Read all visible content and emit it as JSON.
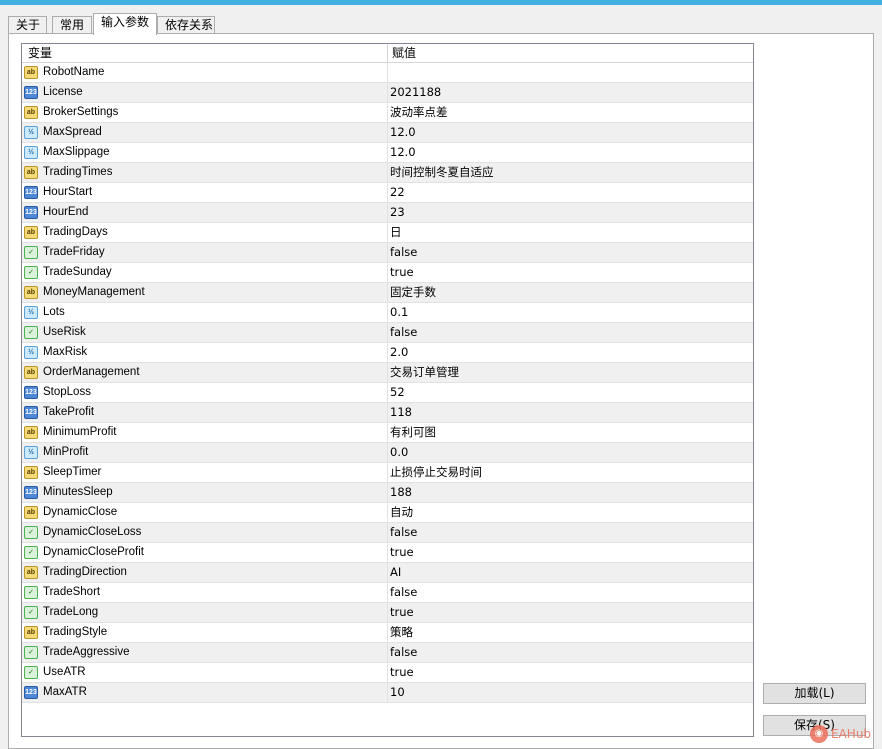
{
  "tabs": [
    {
      "label": "关于",
      "active": false
    },
    {
      "label": "常用",
      "active": false
    },
    {
      "label": "输入参数",
      "active": true
    },
    {
      "label": "依存关系",
      "active": false
    }
  ],
  "grid": {
    "columns": {
      "variable": "变量",
      "value": "赋值"
    },
    "rows": [
      {
        "type": "ab",
        "name": "RobotName",
        "value": ""
      },
      {
        "type": "123",
        "name": "License",
        "value": "2021188"
      },
      {
        "type": "ab",
        "name": "BrokerSettings",
        "value": "波动率点差"
      },
      {
        "type": "½",
        "name": "MaxSpread",
        "value": "12.0"
      },
      {
        "type": "½",
        "name": "MaxSlippage",
        "value": "12.0"
      },
      {
        "type": "ab",
        "name": "TradingTimes",
        "value": "时间控制冬夏自适应"
      },
      {
        "type": "123",
        "name": "HourStart",
        "value": "22"
      },
      {
        "type": "123",
        "name": "HourEnd",
        "value": "23"
      },
      {
        "type": "ab",
        "name": "TradingDays",
        "value": "日"
      },
      {
        "type": "bool",
        "name": "TradeFriday",
        "value": "false"
      },
      {
        "type": "bool",
        "name": "TradeSunday",
        "value": "true"
      },
      {
        "type": "ab",
        "name": "MoneyManagement",
        "value": "固定手数"
      },
      {
        "type": "½",
        "name": "Lots",
        "value": "0.1"
      },
      {
        "type": "bool",
        "name": "UseRisk",
        "value": "false"
      },
      {
        "type": "½",
        "name": "MaxRisk",
        "value": "2.0"
      },
      {
        "type": "ab",
        "name": "OrderManagement",
        "value": "交易订单管理"
      },
      {
        "type": "123",
        "name": "StopLoss",
        "value": "52"
      },
      {
        "type": "123",
        "name": "TakeProfit",
        "value": "118"
      },
      {
        "type": "ab",
        "name": "MinimumProfit",
        "value": "有利可图"
      },
      {
        "type": "½",
        "name": "MinProfit",
        "value": "0.0"
      },
      {
        "type": "ab",
        "name": "SleepTimer",
        "value": "止损停止交易时间"
      },
      {
        "type": "123",
        "name": "MinutesSleep",
        "value": "188"
      },
      {
        "type": "ab",
        "name": "DynamicClose",
        "value": "自动"
      },
      {
        "type": "bool",
        "name": "DynamicCloseLoss",
        "value": "false"
      },
      {
        "type": "bool",
        "name": "DynamicCloseProfit",
        "value": "true"
      },
      {
        "type": "ab",
        "name": "TradingDirection",
        "value": "AI"
      },
      {
        "type": "bool",
        "name": "TradeShort",
        "value": "false"
      },
      {
        "type": "bool",
        "name": "TradeLong",
        "value": "true"
      },
      {
        "type": "ab",
        "name": "TradingStyle",
        "value": "策略"
      },
      {
        "type": "bool",
        "name": "TradeAggressive",
        "value": "false"
      },
      {
        "type": "bool",
        "name": "UseATR",
        "value": "true"
      },
      {
        "type": "123",
        "name": "MaxATR",
        "value": "10"
      }
    ]
  },
  "buttons": {
    "load_label": "加载(L)",
    "save_label": "保存(S)"
  },
  "watermark": {
    "icon": "fox-logo-icon",
    "text": "EAHub"
  },
  "icon_types": {
    "ab": "string-type-icon",
    "123": "integer-type-icon",
    "½": "double-type-icon",
    "bool": "boolean-type-icon"
  },
  "colors": {
    "accent": "#43b0e3",
    "watermark": "#ec6f5a"
  }
}
